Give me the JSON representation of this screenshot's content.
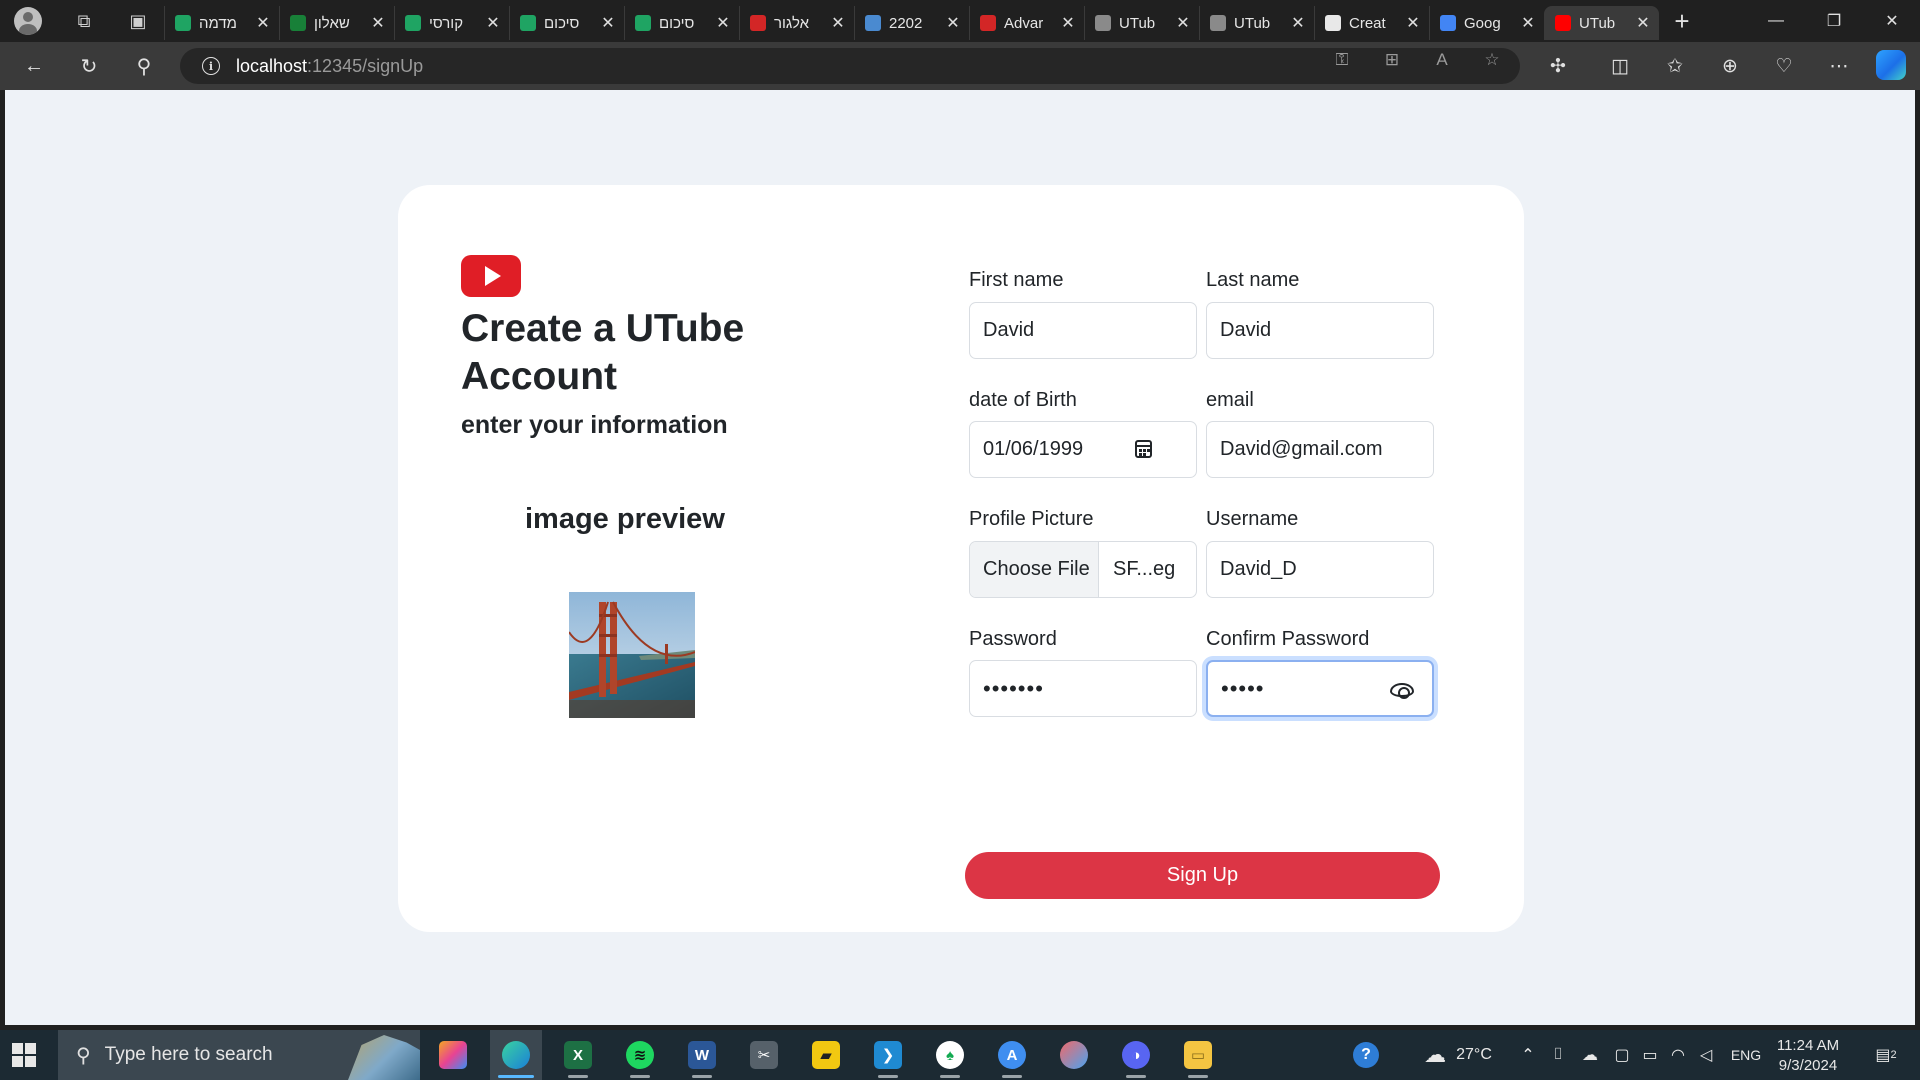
{
  "browser": {
    "tabs": [
      {
        "label": "מדמה",
        "favicon": "google-drive",
        "color": "#1fa463"
      },
      {
        "label": "שאלון",
        "favicon": "google-sheets",
        "color": "#188038"
      },
      {
        "label": "קורסי",
        "favicon": "google-drive",
        "color": "#1fa463"
      },
      {
        "label": "סיכום",
        "favicon": "google-drive",
        "color": "#1fa463"
      },
      {
        "label": "סיכום",
        "favicon": "google-drive",
        "color": "#1fa463"
      },
      {
        "label": "אלגור",
        "favicon": "youtube",
        "color": "#d32626"
      },
      {
        "label": "2202",
        "favicon": "arabic-doc",
        "color": "#4a8ad0"
      },
      {
        "label": "Advar",
        "favicon": "youtube",
        "color": "#d32626"
      },
      {
        "label": "UTub",
        "favicon": "chatgpt",
        "color": "#8a8a8a"
      },
      {
        "label": "UTub",
        "favicon": "chatgpt",
        "color": "#8a8a8a"
      },
      {
        "label": "Creat",
        "favicon": "github",
        "color": "#e8e8e8"
      },
      {
        "label": "Goog",
        "favicon": "google-translate",
        "color": "#4285f4"
      },
      {
        "label": "UTub",
        "favicon": "youtube",
        "color": "#ff0000",
        "active": true
      }
    ],
    "url_host": "localhost",
    "url_path": ":12345/signUp"
  },
  "page": {
    "title": "Create a UTube Account",
    "subtitle": "enter your information",
    "preview_title": "image preview",
    "form": {
      "first_name_label": "First name",
      "first_name_value": "David",
      "last_name_label": "Last name",
      "last_name_value": "David",
      "dob_label": "date of Birth",
      "dob_value": "01/06/1999",
      "email_label": "email",
      "email_value": "David@gmail.com",
      "picture_label": "Profile Picture",
      "choose_file_label": "Choose File",
      "file_name": "SF...eg",
      "username_label": "Username",
      "username_value": "David_D",
      "password_label": "Password",
      "password_value": "•••••••",
      "confirm_label": "Confirm Password",
      "confirm_value": "•••••",
      "submit_label": "Sign Up"
    }
  },
  "taskbar": {
    "search_placeholder": "Type here to search",
    "weather": "27°C",
    "language": "ENG",
    "time": "11:24 AM",
    "date": "9/3/2024",
    "notifications": "2"
  }
}
